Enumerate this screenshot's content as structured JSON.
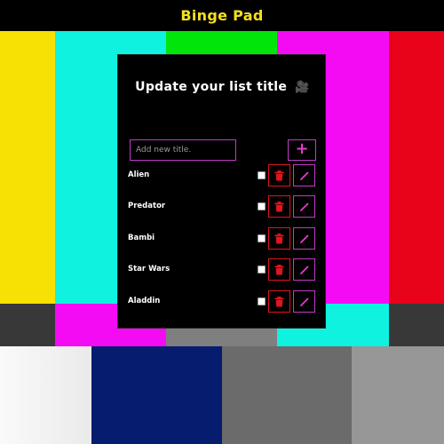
{
  "app": {
    "title": "Binge Pad"
  },
  "colors": {
    "accent_yellow": "#f5e11c",
    "accent_magenta": "#c13bc8",
    "delete_red": "#e0151f"
  },
  "panel": {
    "title": "Update your list title",
    "title_icon": "film-icon"
  },
  "new_title": {
    "placeholder": "Add new title.",
    "value": "",
    "add_label": "+"
  },
  "items": [
    {
      "label": "Alien",
      "checked": false
    },
    {
      "label": "Predator",
      "checked": false
    },
    {
      "label": "Bambi",
      "checked": false
    },
    {
      "label": "Star Wars",
      "checked": false
    },
    {
      "label": "Aladdin",
      "checked": false
    }
  ],
  "icons": {
    "delete": "trash-icon",
    "edit": "pencil-icon"
  }
}
